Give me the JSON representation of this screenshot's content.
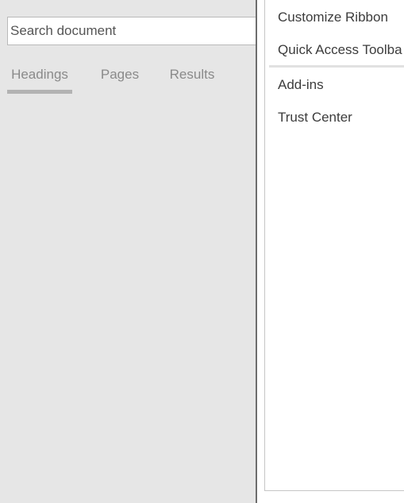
{
  "navigation": {
    "search": {
      "placeholder": "Search document",
      "value": ""
    },
    "tabs": [
      {
        "label": "Headings",
        "active": true
      },
      {
        "label": "Pages",
        "active": false
      },
      {
        "label": "Results",
        "active": false
      }
    ]
  },
  "options_menu": {
    "items": [
      {
        "label": "Customize Ribbon"
      },
      {
        "label": "Quick Access Toolba"
      },
      {
        "label": "Add-ins"
      },
      {
        "label": "Trust Center"
      }
    ]
  },
  "colors": {
    "pane_background": "#e6e6e6",
    "panel_background": "#ffffff",
    "active_tab_underline": "#b3b3b3",
    "divider": "#6d6d6d"
  }
}
